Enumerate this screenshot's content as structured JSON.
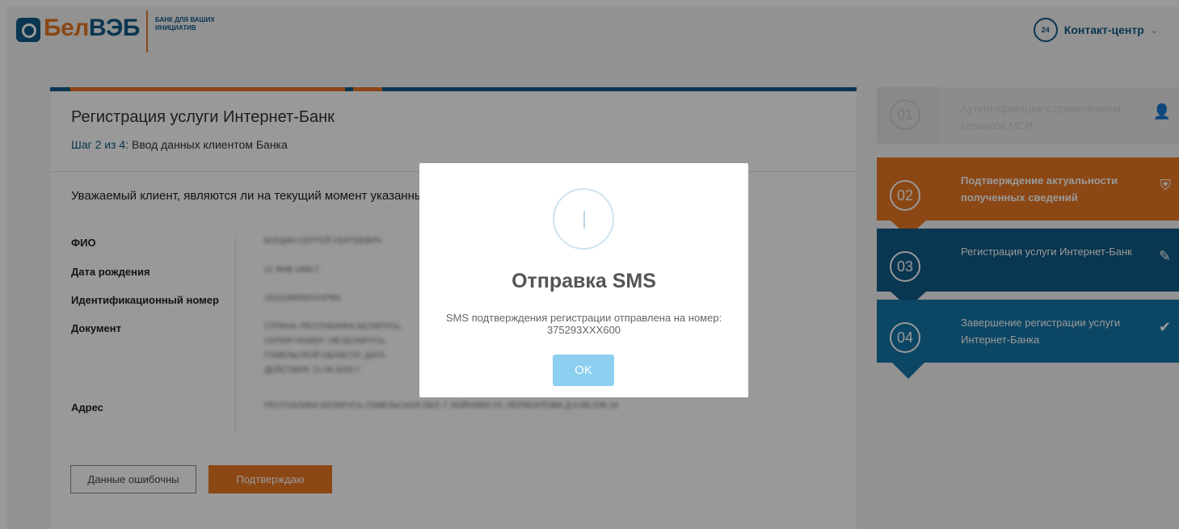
{
  "header": {
    "logo_part1": "Бел",
    "logo_part2": "ВЭБ",
    "logo_tagline": "БАНК ДЛЯ ВАШИХ ИНИЦИАТИВ",
    "contact_label": "Контакт-центр",
    "contact_icon": "phone-24-icon"
  },
  "card": {
    "title": "Регистрация услуги Интернет-Банк",
    "step_num": "Шаг 2 из 4:",
    "step_text": " Ввод данных клиентом Банка",
    "question": "Уважаемый клиент, являются ли на текущий момент указанные",
    "fields": [
      {
        "label": "ФИО",
        "value": "БОГДАН СЕРГЕЙ СЕРГЕЕВИЧ"
      },
      {
        "label": "Дата рождения",
        "value": "21 ЯНВ 1990 Г."
      },
      {
        "label": "Идентификационный номер",
        "value": "3310190000ХХХРВ4"
      },
      {
        "label": "Документ",
        "value": "СТРАНА: РЕСПУБЛИКА БЕЛАРУСЬ, СЕРИЯ НОМЕР: НВ БЕЛАРУСЬ, ГОМЕЛЬСКОЙ ОБЛАСТИ, ДАТА ДЕЙСТВИЯ: 21.08.2025 Г."
      },
      {
        "label": "Адрес",
        "value": "РЕСПУБЛИКА БЕЛАРУСЬ ГОМЕЛЬСКАЯ ОБЛ. Г ХОЙНИКИ УЛ. ЛЕРМОНТОВА Д.9 КВ./ОФ.16"
      }
    ],
    "btn_wrong": "Данные ошибочны",
    "btn_confirm": "Подтверждаю"
  },
  "steps": [
    {
      "num": "01",
      "label": "Аутентификация с применением сервисов МСИ",
      "icon": "person-icon"
    },
    {
      "num": "02",
      "label": "Подтверждение актуальности полученных сведений",
      "icon": "shield-check-icon"
    },
    {
      "num": "03",
      "label": "Регистрация услуги Интернет-Банк",
      "icon": "pencil-icon"
    },
    {
      "num": "04",
      "label": "Завершение регистрации услуги Интернет-Банка",
      "icon": "check-circle-icon"
    }
  ],
  "modal": {
    "title": "Отправка SMS",
    "text": "SMS подтверждения регистрации отправлена на номер: 375293XXX600",
    "ok": "OK",
    "icon": "info-icon"
  },
  "colors": {
    "brand_orange": "#e87722",
    "brand_blue": "#0f5a86",
    "step4_blue": "#1576a8",
    "ok_button": "#8ccff0"
  }
}
